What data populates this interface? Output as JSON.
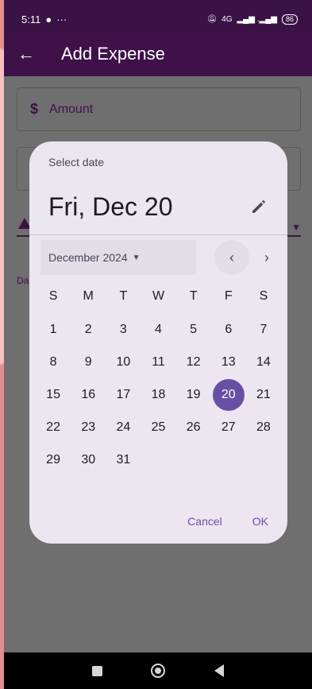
{
  "status_bar": {
    "time": "5:11",
    "dots": "···",
    "network": "4G",
    "battery": "86"
  },
  "app_bar": {
    "title": "Add Expense"
  },
  "form": {
    "amount_label": "Amount",
    "date_label_fragment": "Da"
  },
  "date_picker": {
    "subtitle": "Select date",
    "headline": "Fri, Dec 20",
    "month_label": "December 2024",
    "weekdays": [
      "S",
      "M",
      "T",
      "W",
      "T",
      "F",
      "S"
    ],
    "weeks": [
      [
        "1",
        "2",
        "3",
        "4",
        "5",
        "6",
        "7"
      ],
      [
        "8",
        "9",
        "10",
        "11",
        "12",
        "13",
        "14"
      ],
      [
        "15",
        "16",
        "17",
        "18",
        "19",
        "20",
        "21"
      ],
      [
        "22",
        "23",
        "24",
        "25",
        "26",
        "27",
        "28"
      ],
      [
        "29",
        "30",
        "31",
        "",
        "",
        "",
        ""
      ]
    ],
    "selected_day": "20",
    "cancel_label": "Cancel",
    "ok_label": "OK"
  },
  "colors": {
    "app_bar": "#3e1149",
    "accent": "#6750a4",
    "dialog_bg": "#ece6f0"
  }
}
